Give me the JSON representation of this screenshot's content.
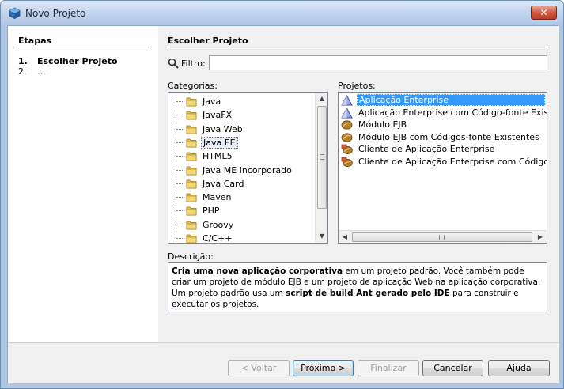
{
  "window": {
    "title": "Novo Projeto",
    "close_glyph": "✕"
  },
  "steps": {
    "title": "Etapas",
    "items": [
      {
        "num": "1.",
        "label": "Escolher Projeto"
      },
      {
        "num": "2.",
        "label": "..."
      }
    ]
  },
  "main": {
    "title": "Escolher Projeto",
    "filter": {
      "label": "Filtro:",
      "value": "",
      "placeholder": ""
    },
    "categories_label": "Categorias:",
    "projects_label": "Projetos:",
    "categories": [
      "Java",
      "JavaFX",
      "Java Web",
      "Java EE",
      "HTML5",
      "Java ME Incorporado",
      "Java Card",
      "Maven",
      "PHP",
      "Groovy",
      "C/C++"
    ],
    "selected_category": "Java EE",
    "projects": [
      {
        "label": "Aplicação Enterprise",
        "icon": "triangle-icon"
      },
      {
        "label": "Aplicação Enterprise com Código-fonte Existente",
        "icon": "triangle-icon"
      },
      {
        "label": "Módulo EJB",
        "icon": "bean-icon"
      },
      {
        "label": "Módulo EJB com Códigos-fonte Existentes",
        "icon": "bean-icon"
      },
      {
        "label": "Cliente de Aplicação Enterprise",
        "icon": "client-bean-icon"
      },
      {
        "label": "Cliente de Aplicação Enterprise com Códigos-fonte E",
        "icon": "client-bean-icon"
      }
    ],
    "selected_project": "Aplicação Enterprise",
    "description_label": "Descrição:",
    "description": {
      "p1_bold": "Cria uma nova aplicação corporativa",
      "p1": " em um projeto padrão. Você também pode criar um projeto de módulo EJB e um projeto de aplicação Web na aplicação corporativa. Um projeto padrão usa um ",
      "p2_bold": "script de build Ant gerado pelo IDE",
      "p2": " para construir e executar os projetos."
    }
  },
  "buttons": {
    "back": "< Voltar",
    "next": "Próximo >",
    "finish": "Finalizar",
    "cancel": "Cancelar",
    "help": "Ajuda"
  },
  "colors": {
    "selection": "#3399ff",
    "folder": "#e8c04a"
  }
}
